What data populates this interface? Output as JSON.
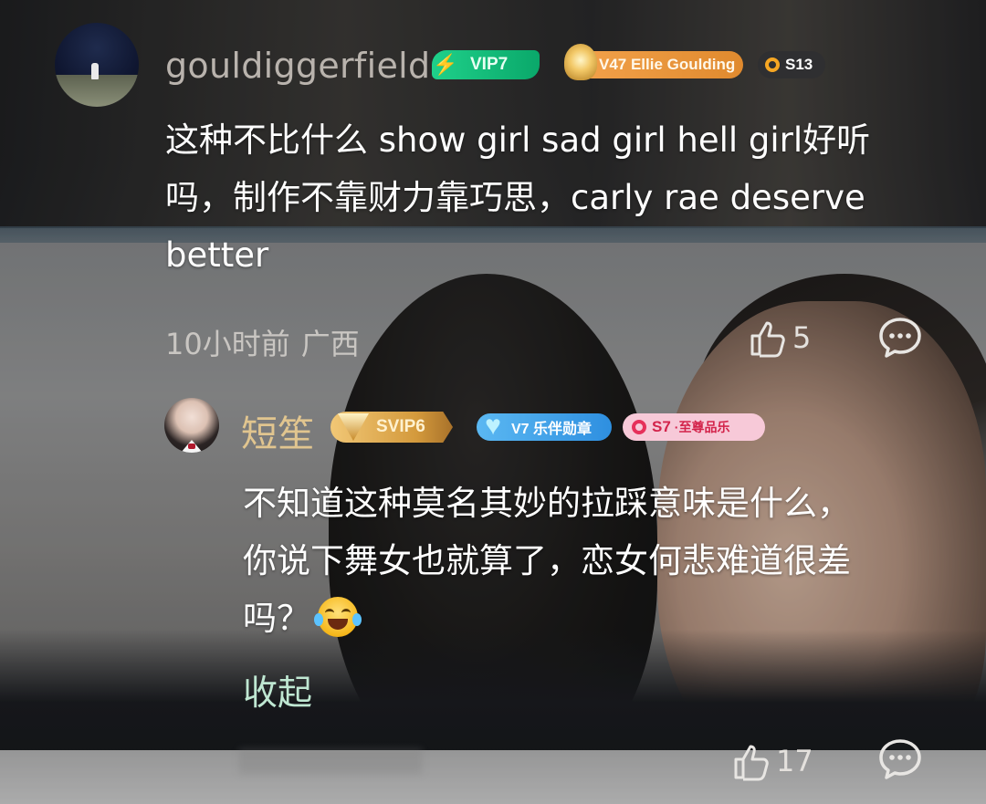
{
  "comments": [
    {
      "username": "gouldiggerfield",
      "badges": {
        "vip": "VIP7",
        "fan": "V47 Ellie Goulding",
        "season": "S13"
      },
      "text_lines": [
        "这种不比什么 show girl  sad girl hell girl好听",
        "吗，制作不靠财力靠巧思，carly rae deserve",
        "better"
      ],
      "time": "10小时前",
      "region": "广西",
      "likes": "5"
    },
    {
      "username": "短笙",
      "badges": {
        "vip": "SVIP6",
        "fan": "V7 乐伴勋章",
        "season": "S7",
        "season_sub": "·至尊品乐"
      },
      "text_lines": [
        "不知道这种莫名其妙的拉踩意味是什么，",
        "你说下舞女也就算了，恋女何悲难道很差",
        "吗？"
      ],
      "emoji": "laughing-tears-emoji",
      "collapse_label": "收起",
      "likes": "17"
    }
  ],
  "icons": {
    "like": "thumbs-up-icon",
    "comment": "comment-bubble-icon",
    "vip_bolt": "lightning-icon"
  },
  "colors": {
    "username_1": "#b9b3ad",
    "username_2": "#e1c58f",
    "vip_green": "#1fd08a",
    "fan_orange": "#f3a34d",
    "svip_gold": "#d49a3c",
    "fan_blue": "#2e8fe0",
    "season_pink": "#f7c9d8",
    "collapse_green": "#bfe7d2"
  }
}
